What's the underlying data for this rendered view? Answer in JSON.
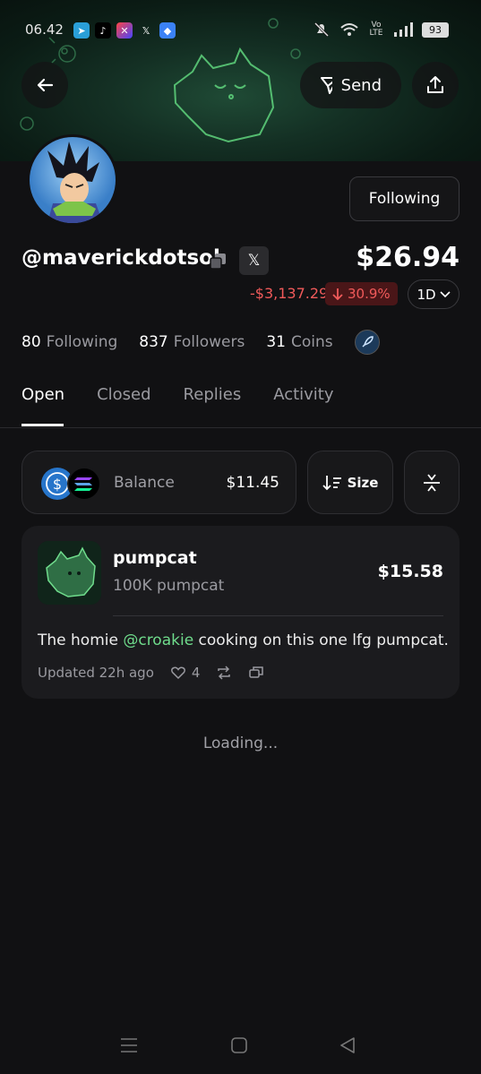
{
  "status_bar": {
    "time": "06.42",
    "network": "Vo LTE",
    "battery": "93"
  },
  "header": {
    "send_label": "Send"
  },
  "profile": {
    "following_button": "Following",
    "handle": "@maverickdotsol",
    "x_label": "𝕏",
    "portfolio_value": "$26.94",
    "pnl": "-$3,137.29",
    "change_pct": "30.9%",
    "range": "1D",
    "stats": {
      "following_count": "80",
      "following_label": "Following",
      "followers_count": "837",
      "followers_label": "Followers",
      "coins_count": "31",
      "coins_label": "Coins"
    }
  },
  "tabs": [
    "Open",
    "Closed",
    "Replies",
    "Activity"
  ],
  "balance": {
    "label": "Balance",
    "value": "$11.45"
  },
  "sort": {
    "label": "Size"
  },
  "position": {
    "name": "pumpcat",
    "amount": "100K pumpcat",
    "value": "$15.58",
    "post_prefix": "The homie ",
    "post_mention": "@croakie",
    "post_suffix": " cooking on this one lfg pumpcat.",
    "updated": "Updated 22h ago",
    "likes": "4"
  },
  "loading_text": "Loading...",
  "colors": {
    "background": "#111113",
    "negative": "#f05a5a",
    "mention": "#6fdc8c",
    "banner": "#143024"
  }
}
